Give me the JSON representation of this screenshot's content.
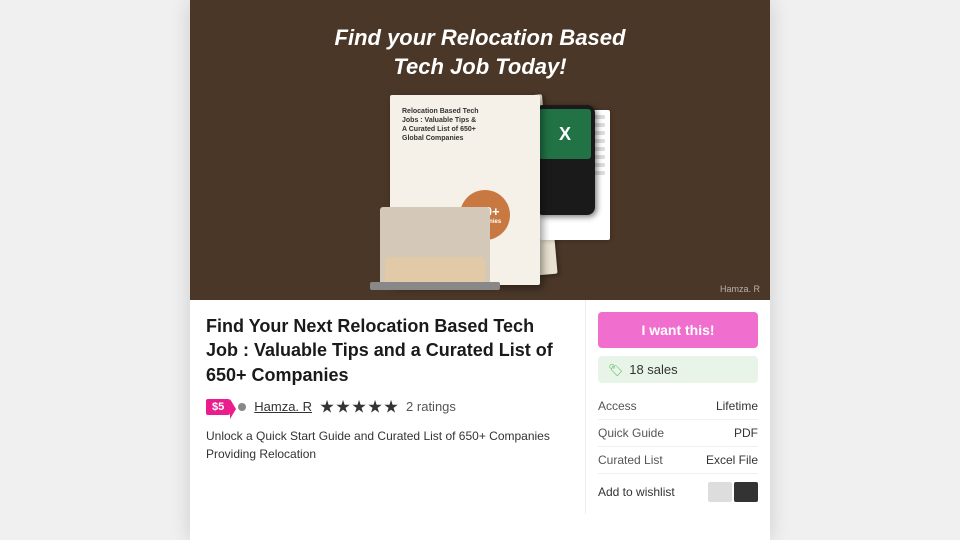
{
  "hero": {
    "title": "Find your Relocation Based\nTech Job Today!",
    "credit": "Hamza. R"
  },
  "book": {
    "title": "Relocation Based Tech\nJobs : Valuable Tips &\nA Curated List of 650+\nGlobal Companies",
    "badge_text": "650+",
    "badge_sub": "Companies"
  },
  "product": {
    "title": "Find Your Next Relocation Based Tech Job : Valuable Tips and a Curated List of 650+ Companies",
    "price": "$5",
    "author": "Hamza. R",
    "ratings_count": "2 ratings",
    "description": "Unlock a Quick Start Guide and Curated List of 650+ Companies Providing Relocation"
  },
  "sidebar": {
    "want_button": "I want this!",
    "sales_count": "18 sales",
    "access_label": "Access",
    "access_value": "Lifetime",
    "quick_guide_label": "Quick Guide",
    "quick_guide_value": "PDF",
    "curated_list_label": "Curated List",
    "curated_list_value": "Excel File",
    "wishlist_label": "Add to wishlist"
  }
}
